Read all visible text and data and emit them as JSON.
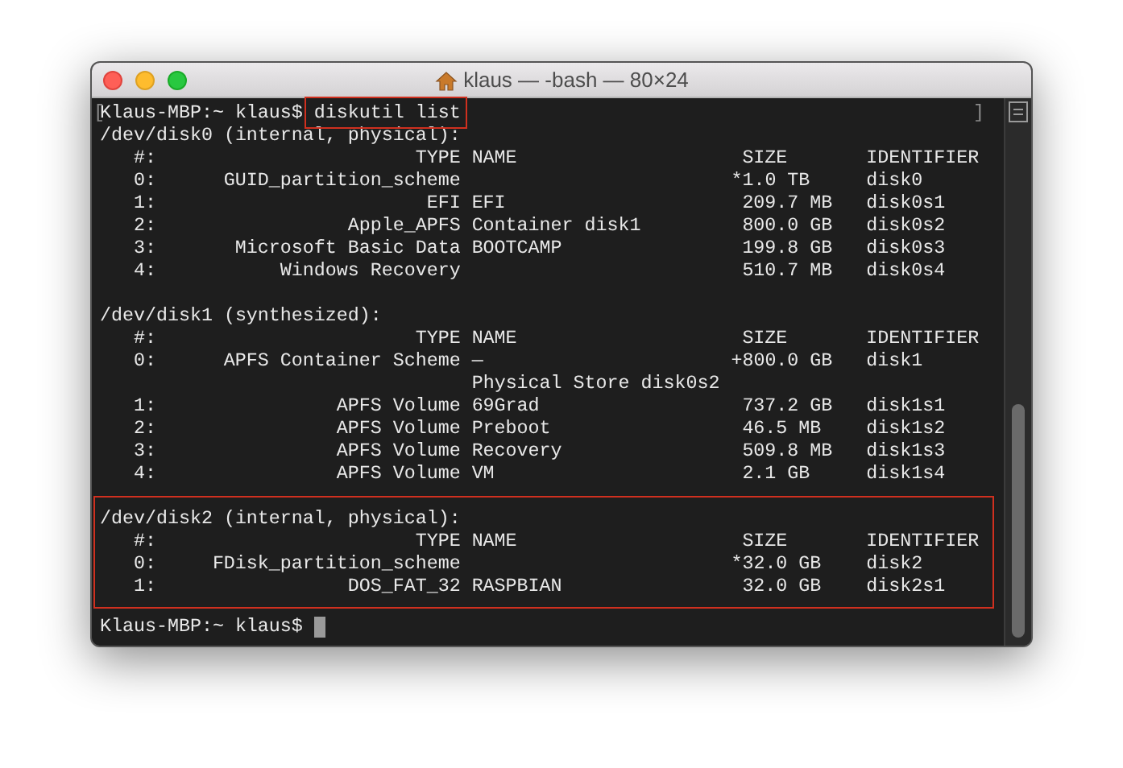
{
  "window": {
    "title": "klaus — -bash — 80×24"
  },
  "command": {
    "bracket_open": "[",
    "prompt": "Klaus-MBP:~ klaus$",
    "text": "diskutil list",
    "highlighted": true,
    "bracket_close": "]"
  },
  "disks": [
    {
      "header": "/dev/disk0 (internal, physical):",
      "highlighted": false,
      "columns": {
        "index": "#:",
        "type": "TYPE",
        "name": "NAME",
        "size": "SIZE",
        "identifier": "IDENTIFIER"
      },
      "rows": [
        {
          "kind": "scheme",
          "index": "0:",
          "type": "GUID_partition_scheme",
          "size": "*1.0 TB",
          "identifier": "disk0"
        },
        {
          "kind": "partition",
          "index": "1:",
          "type": "EFI",
          "name": "EFI",
          "size": "209.7 MB",
          "identifier": "disk0s1"
        },
        {
          "kind": "partition",
          "index": "2:",
          "type": "Apple_APFS",
          "name": "Container disk1",
          "size": "800.0 GB",
          "identifier": "disk0s2"
        },
        {
          "kind": "partition",
          "index": "3:",
          "type": "Microsoft Basic Data",
          "name": "BOOTCAMP",
          "size": "199.8 GB",
          "identifier": "disk0s3"
        },
        {
          "kind": "partition",
          "index": "4:",
          "type": "Windows Recovery",
          "size": "510.7 MB",
          "identifier": "disk0s4"
        }
      ]
    },
    {
      "header": "/dev/disk1 (synthesized):",
      "highlighted": false,
      "columns": {
        "index": "#:",
        "type": "TYPE",
        "name": "NAME",
        "size": "SIZE",
        "identifier": "IDENTIFIER"
      },
      "rows": [
        {
          "kind": "scheme",
          "index": "0:",
          "type": "APFS Container Scheme",
          "name": "—",
          "size": "+800.0 GB",
          "identifier": "disk1"
        },
        {
          "kind": "continuation",
          "name": "Physical Store disk0s2"
        },
        {
          "kind": "partition",
          "index": "1:",
          "type": "APFS Volume",
          "name": "69Grad",
          "size": "737.2 GB",
          "identifier": "disk1s1"
        },
        {
          "kind": "partition",
          "index": "2:",
          "type": "APFS Volume",
          "name": "Preboot",
          "size": "46.5 MB",
          "identifier": "disk1s2"
        },
        {
          "kind": "partition",
          "index": "3:",
          "type": "APFS Volume",
          "name": "Recovery",
          "size": "509.8 MB",
          "identifier": "disk1s3"
        },
        {
          "kind": "partition",
          "index": "4:",
          "type": "APFS Volume",
          "name": "VM",
          "size": "2.1 GB",
          "identifier": "disk1s4"
        }
      ]
    },
    {
      "header": "/dev/disk2 (internal, physical):",
      "highlighted": true,
      "columns": {
        "index": "#:",
        "type": "TYPE",
        "name": "NAME",
        "size": "SIZE",
        "identifier": "IDENTIFIER"
      },
      "rows": [
        {
          "kind": "scheme",
          "index": "0:",
          "type": "FDisk_partition_scheme",
          "size": "*32.0 GB",
          "identifier": "disk2"
        },
        {
          "kind": "partition",
          "index": "1:",
          "type": "DOS_FAT_32",
          "name": "RASPBIAN",
          "size": "32.0 GB",
          "identifier": "disk2s1"
        }
      ]
    }
  ],
  "final_prompt": {
    "prompt": "Klaus-MBP:~ klaus$"
  }
}
